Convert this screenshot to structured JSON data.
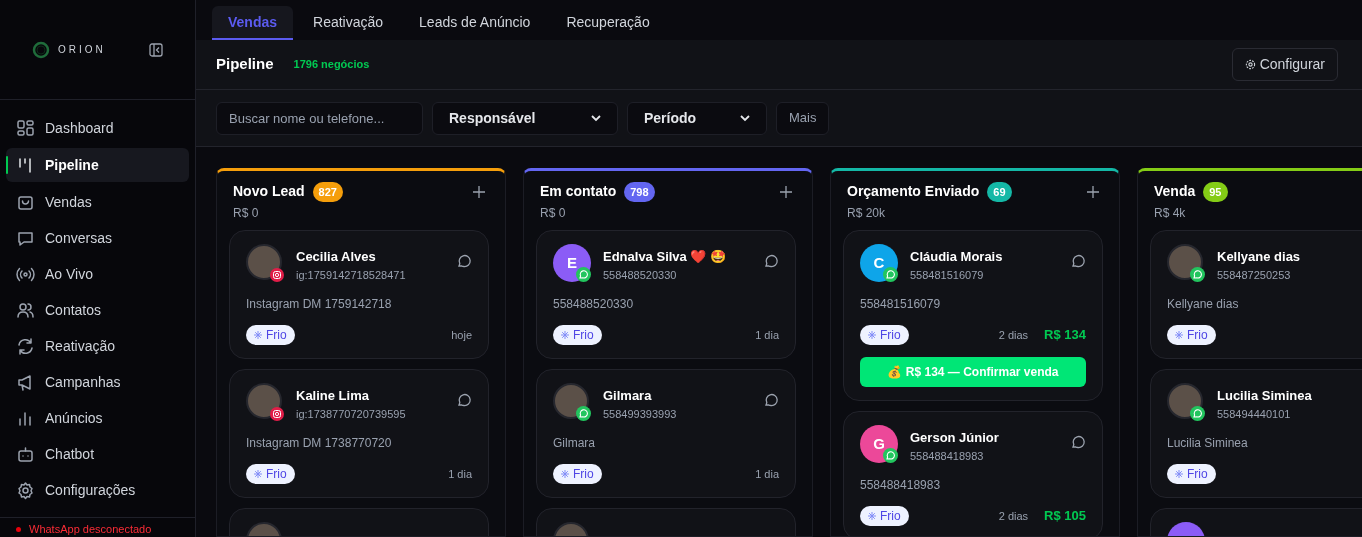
{
  "sidebar": {
    "logo": "ORION",
    "items": [
      {
        "label": "Dashboard",
        "kind": "grid",
        "selected": false
      },
      {
        "label": "Pipeline",
        "kind": "columns",
        "selected": true
      },
      {
        "label": "Vendas",
        "kind": "bag",
        "selected": false
      },
      {
        "label": "Conversas",
        "kind": "chat",
        "selected": false
      },
      {
        "label": "Ao Vivo",
        "kind": "radio",
        "selected": false
      },
      {
        "label": "Contatos",
        "kind": "users",
        "selected": false
      },
      {
        "label": "Reativação",
        "kind": "refresh",
        "selected": false
      },
      {
        "label": "Campanhas",
        "kind": "megaphone",
        "selected": false
      },
      {
        "label": "Anúncios",
        "kind": "bars",
        "selected": false
      },
      {
        "label": "Chatbot",
        "kind": "bot",
        "selected": false
      },
      {
        "label": "Configurações",
        "kind": "gear",
        "selected": false
      }
    ],
    "status": "WhatsApp desconectado"
  },
  "tabs": [
    {
      "label": "Vendas",
      "selected": true
    },
    {
      "label": "Reativação",
      "selected": false
    },
    {
      "label": "Leads de Anúncio",
      "selected": false
    },
    {
      "label": "Recuperação",
      "selected": false
    }
  ],
  "header": {
    "title": "Pipeline",
    "count": "1796 negócios",
    "button": "Configurar"
  },
  "filters": {
    "search": {
      "placeholder": "Buscar nome ou telefone..."
    },
    "selects": [
      "Responsável",
      "Período"
    ],
    "more": "Mais"
  },
  "columns": [
    {
      "title": "Novo Lead",
      "count": "827",
      "color": "#f59e0b",
      "total": "R$ 0",
      "cards": [
        {
          "name": "Cecilia Alves",
          "handle": "ig:1759142718528471",
          "note": "Instagram DM 1759142718",
          "avatar": {
            "kind": "photo",
            "badge": {
              "kind": "instagram"
            }
          },
          "tag": "Frio",
          "time": "hoje"
        },
        {
          "name": "Kaline Lima",
          "handle": "ig:1738770720739595",
          "note": "Instagram DM 1738770720",
          "avatar": {
            "kind": "photo",
            "badge": {
              "kind": "instagram"
            }
          },
          "tag": "Frio",
          "time": "1 dia"
        },
        {
          "avatar": {
            "kind": "photo"
          }
        }
      ]
    },
    {
      "title": "Em contato",
      "count": "798",
      "color": "#6366f1",
      "total": "R$ 0",
      "cards": [
        {
          "name": "Ednalva Silva ❤️ 🤩",
          "handle": "558488520330",
          "note": "558488520330",
          "avatar": {
            "kind": "initial",
            "initial": "E",
            "color": "#8b5cf6",
            "badge": {
              "kind": "whatsapp"
            }
          },
          "tag": "Frio",
          "time": "1 dia"
        },
        {
          "name": "Gilmara",
          "handle": "558499393993",
          "note": "Gilmara",
          "avatar": {
            "kind": "photo",
            "badge": {
              "kind": "whatsapp"
            }
          },
          "tag": "Frio",
          "time": "1 dia"
        },
        {
          "avatar": {
            "kind": "photo"
          }
        }
      ]
    },
    {
      "title": "Orçamento Enviado",
      "count": "69",
      "color": "#14b8a6",
      "total": "R$ 20k",
      "cards": [
        {
          "name": "Cláudia Morais",
          "handle": "558481516079",
          "note": "558481516079",
          "avatar": {
            "kind": "initial",
            "initial": "C",
            "color": "#0ea5e9",
            "badge": {
              "kind": "whatsapp"
            }
          },
          "tag": "Frio",
          "time": "2 dias",
          "value": "R$ 134",
          "action": "💰 R$ 134 — Confirmar venda"
        },
        {
          "name": "Gerson Júnior",
          "handle": "558488418983",
          "note": "558488418983",
          "avatar": {
            "kind": "initial",
            "initial": "G",
            "color": "#ec4899",
            "badge": {
              "kind": "whatsapp"
            }
          },
          "tag": "Frio",
          "time": "2 dias",
          "value": "R$ 105"
        }
      ]
    },
    {
      "title": "Venda",
      "count": "95",
      "color": "#84cc16",
      "total": "R$ 4k",
      "cards": [
        {
          "name": "Kellyane dias",
          "handle": "558487250253",
          "note": "Kellyane dias",
          "avatar": {
            "kind": "photo",
            "badge": {
              "kind": "whatsapp"
            }
          },
          "tag": "Frio"
        },
        {
          "name": "Lucilia Siminea",
          "handle": "558494440101",
          "note": "Lucilia Siminea",
          "avatar": {
            "kind": "photo",
            "badge": {
              "kind": "whatsapp"
            }
          },
          "tag": "Frio"
        },
        {
          "avatar": {
            "kind": "initial",
            "color": "#8b5cf6"
          }
        }
      ]
    }
  ]
}
